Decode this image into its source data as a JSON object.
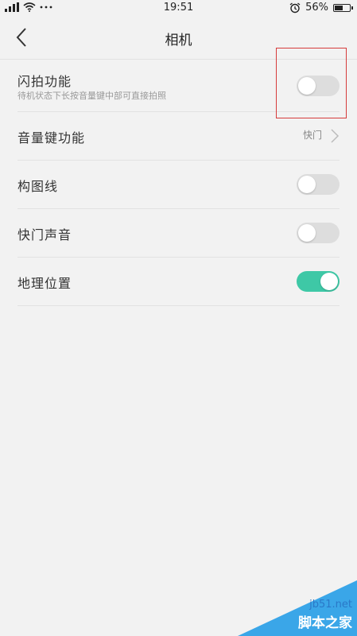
{
  "status_bar": {
    "time": "19:51",
    "battery_percent": "56%",
    "battery_level": 0.56,
    "icons": [
      "signal-icon",
      "wifi-icon",
      "more-dots-icon",
      "alarm-icon",
      "battery-icon"
    ]
  },
  "header": {
    "title": "相机",
    "back_icon": "chevron-left-icon"
  },
  "settings": [
    {
      "label": "闪拍功能",
      "sublabel": "待机状态下长按音量键中部可直接拍照",
      "control": "toggle",
      "on": false
    },
    {
      "label": "音量键功能",
      "value": "快门",
      "control": "chevron"
    },
    {
      "label": "构图线",
      "control": "toggle",
      "on": false
    },
    {
      "label": "快门声音",
      "control": "toggle",
      "on": false
    },
    {
      "label": "地理位置",
      "control": "toggle",
      "on": true
    }
  ],
  "colors": {
    "toggle_on": "#3ec8a6",
    "toggle_off": "#dddddd",
    "highlight_box": "#d63b3b"
  },
  "watermark": {
    "site": "jb51.net",
    "text": "脚本之家"
  }
}
